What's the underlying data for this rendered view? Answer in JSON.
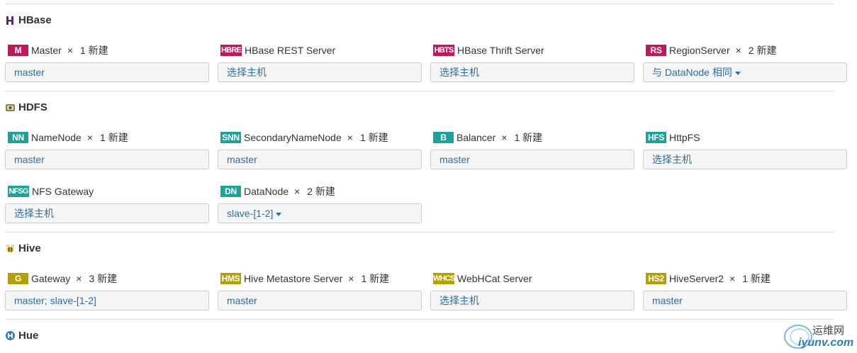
{
  "colors": {
    "hbase_badge": "#c2185b",
    "hdfs_badge": "#1aa39a",
    "hive_badge": "#b5a000",
    "link": "#2a6fa0"
  },
  "sections": {
    "hbase": {
      "title": "HBase",
      "icon": "hbase-icon",
      "roles": [
        {
          "badge": "M",
          "name": "Master",
          "times": "×",
          "count": "1 新建",
          "host": "master"
        },
        {
          "badge": "HBRE",
          "name": "HBase REST Server",
          "host": "选择主机"
        },
        {
          "badge": "HBTS",
          "name": "HBase Thrift Server",
          "host": "选择主机"
        },
        {
          "badge": "RS",
          "name": "RegionServer",
          "times": "×",
          "count": "2 新建",
          "host": "与 DataNode 相同"
        }
      ]
    },
    "hdfs": {
      "title": "HDFS",
      "icon": "hdfs-icon",
      "roles": [
        {
          "badge": "NN",
          "name": "NameNode",
          "times": "×",
          "count": "1 新建",
          "host": "master"
        },
        {
          "badge": "SNN",
          "name": "SecondaryNameNode",
          "times": "×",
          "count": "1 新建",
          "host": "master"
        },
        {
          "badge": "B",
          "name": "Balancer",
          "times": "×",
          "count": "1 新建",
          "host": "master"
        },
        {
          "badge": "HFS",
          "name": "HttpFS",
          "host": "选择主机"
        },
        {
          "badge": "NFSG",
          "name": "NFS Gateway",
          "host": "选择主机"
        },
        {
          "badge": "DN",
          "name": "DataNode",
          "times": "×",
          "count": "2 新建",
          "host": "slave-[1-2]"
        }
      ]
    },
    "hive": {
      "title": "Hive",
      "icon": "hive-bee-icon",
      "roles": [
        {
          "badge": "G",
          "name": "Gateway",
          "times": "×",
          "count": "3 新建",
          "host": "master; slave-[1-2]"
        },
        {
          "badge": "HMS",
          "name": "Hive Metastore Server",
          "times": "×",
          "count": "1 新建",
          "host": "master"
        },
        {
          "badge": "WHCS",
          "name": "WebHCat Server",
          "host": "选择主机"
        },
        {
          "badge": "HS2",
          "name": "HiveServer2",
          "times": "×",
          "count": "1 新建",
          "host": "master"
        }
      ]
    },
    "hue": {
      "title": "Hue",
      "icon": "hue-icon"
    }
  },
  "watermark": {
    "line1": "运维网",
    "line2": "iyunv.com"
  }
}
